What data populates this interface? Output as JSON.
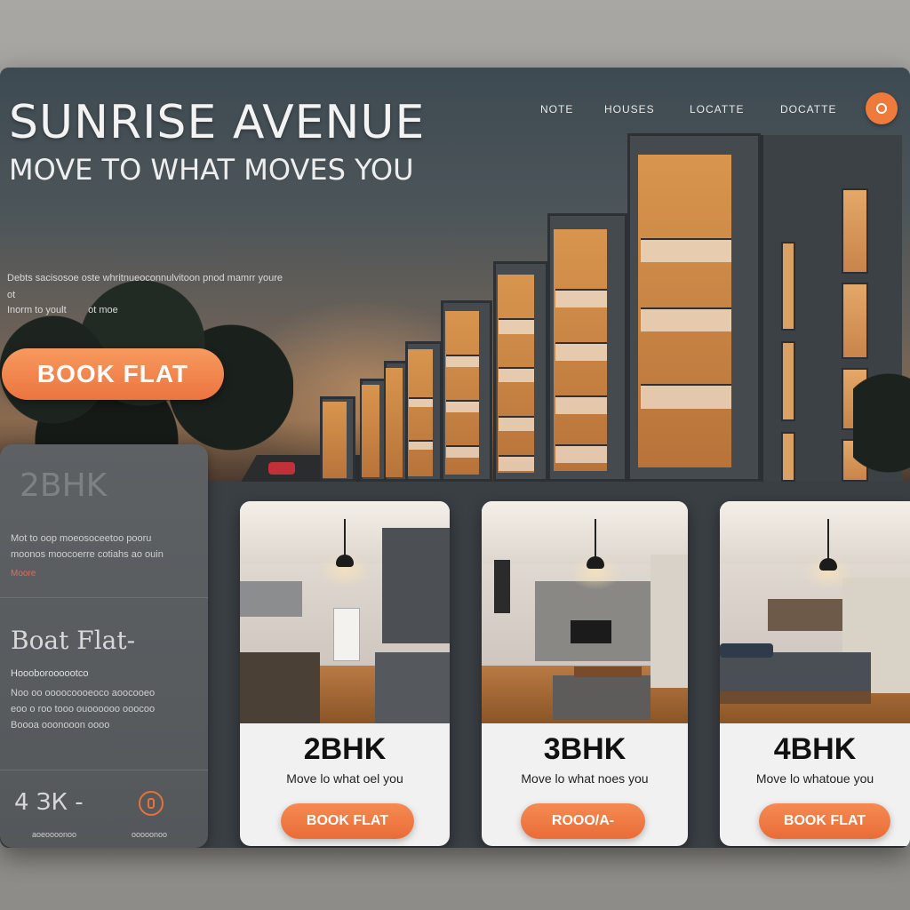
{
  "brand": {
    "title": "SUNRISE AVENUE",
    "tagline": "MOVE TO WHAT MOVES YOU"
  },
  "nav": {
    "items": [
      "NOTE",
      "HOUSES",
      "LOCATTE",
      "DOCATTE"
    ],
    "cta_icon": "circle-icon"
  },
  "hero": {
    "description": "Debts sacisosoe oste whritnueoconnulvitoon pnod mamrr youre ot",
    "description_2": "Inorm to yoult",
    "description_3": "ot moe",
    "book_button": "BOOK FLAT"
  },
  "side_panel": {
    "type_label": "2BHK",
    "text_1": "Mot to oop moeosoceetoo pooru",
    "text_2": "moonos moocoerre cotiahs ao ouin",
    "more_link": "Moore",
    "heading": "Boat Flat-",
    "subheading": "Hoooboroooootco",
    "text_3": "Noo oo oooocoooeoco aoocooeo",
    "text_4": "eoo o roo tooo ouoooooo ooocoo",
    "text_5": "Boooa ooonooon oooo",
    "bottom_label": "4 ЗК -",
    "bottom_icon": "phone-icon",
    "foot_left": "aoeoooonoo",
    "foot_right": "ooooonoo"
  },
  "cards": [
    {
      "title": "2BHK",
      "subtitle": "Move lo what oel you",
      "button": "BOOK FLAT",
      "room": "kitchen"
    },
    {
      "title": "3BHK",
      "subtitle": "Move lo what noes you",
      "button": "ROOO/A-",
      "room": "living"
    },
    {
      "title": "4BHK",
      "subtitle": "Move lo whatoue you",
      "button": "BOOK FLAT",
      "room": "bedroom"
    }
  ],
  "colors": {
    "accent": "#EE7A3C",
    "panel": "#5A5E61",
    "background": "#3A3F44"
  }
}
